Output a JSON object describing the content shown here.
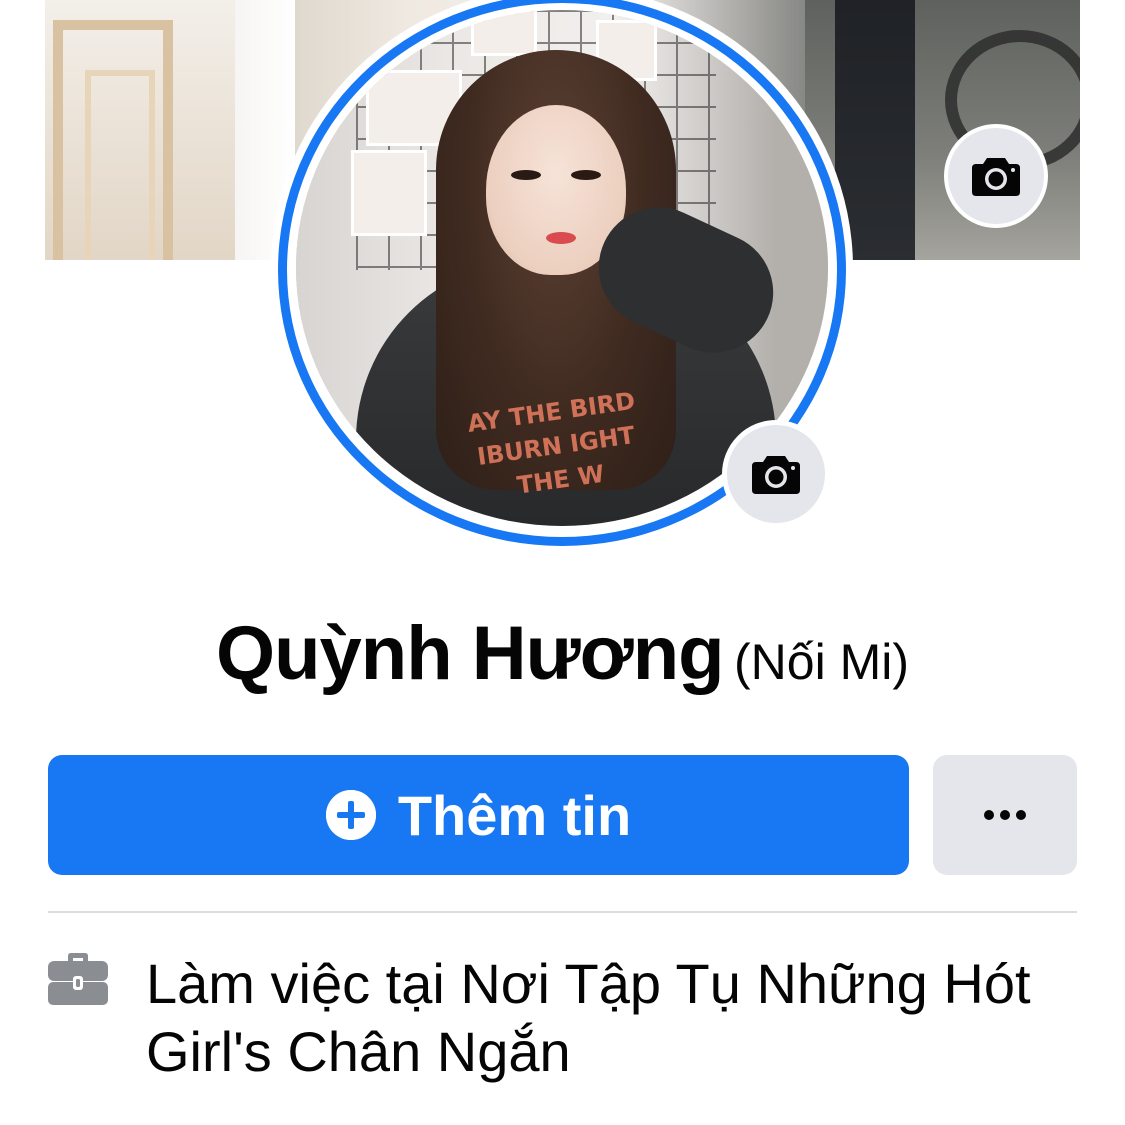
{
  "profile": {
    "name": "Quỳnh Hương",
    "nickname": "(Nối Mi)"
  },
  "icons": {
    "cover_camera": "camera-icon",
    "avatar_camera": "camera-icon",
    "add": "plus-circle-icon",
    "more": "more-horizontal-icon",
    "work": "briefcase-icon"
  },
  "avatar": {
    "shirt_text": "AY THE BIRD IBURN IGHT THE W"
  },
  "actions": {
    "add_story_label": "Thêm tin"
  },
  "details": {
    "work_prefix": "Làm việc tại",
    "work_place": "Nơi Tập Tụ Những Hót Girl's Chân Ngắn"
  },
  "colors": {
    "accent": "#1877f2",
    "secondary_button": "#e4e6eb",
    "divider": "#dadde1",
    "icon_gray": "#8a8d91"
  }
}
